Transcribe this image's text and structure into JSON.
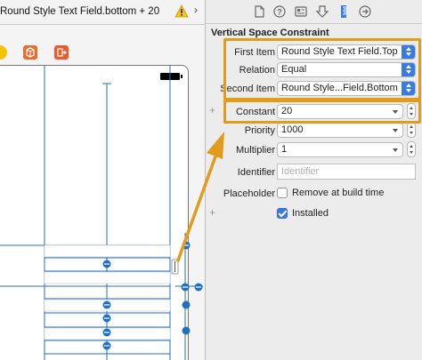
{
  "editor": {
    "breadcrumb": "Round Style Text Field.bottom + 20"
  },
  "inspector": {
    "section_title": "Vertical Space Constraint",
    "first_item": {
      "label": "First Item",
      "value": "Round Style Text Field.Top"
    },
    "relation": {
      "label": "Relation",
      "value": "Equal"
    },
    "second_item": {
      "label": "Second Item",
      "value": "Round Style...Field.Bottom"
    },
    "constant": {
      "label": "Constant",
      "value": "20"
    },
    "priority": {
      "label": "Priority",
      "value": "1000"
    },
    "multiplier": {
      "label": "Multiplier",
      "value": "1"
    },
    "identifier": {
      "label": "Identifier",
      "placeholder": "Identifier"
    },
    "placeholder": {
      "label": "Placeholder",
      "checkbox_label": "Remove at build time",
      "checked": false
    },
    "installed": {
      "checkbox_label": "Installed",
      "checked": true
    }
  },
  "colors": {
    "accent": "#3a7be3",
    "highlight": "#e19c1b",
    "constraint_blue": "#1f6fc5"
  }
}
